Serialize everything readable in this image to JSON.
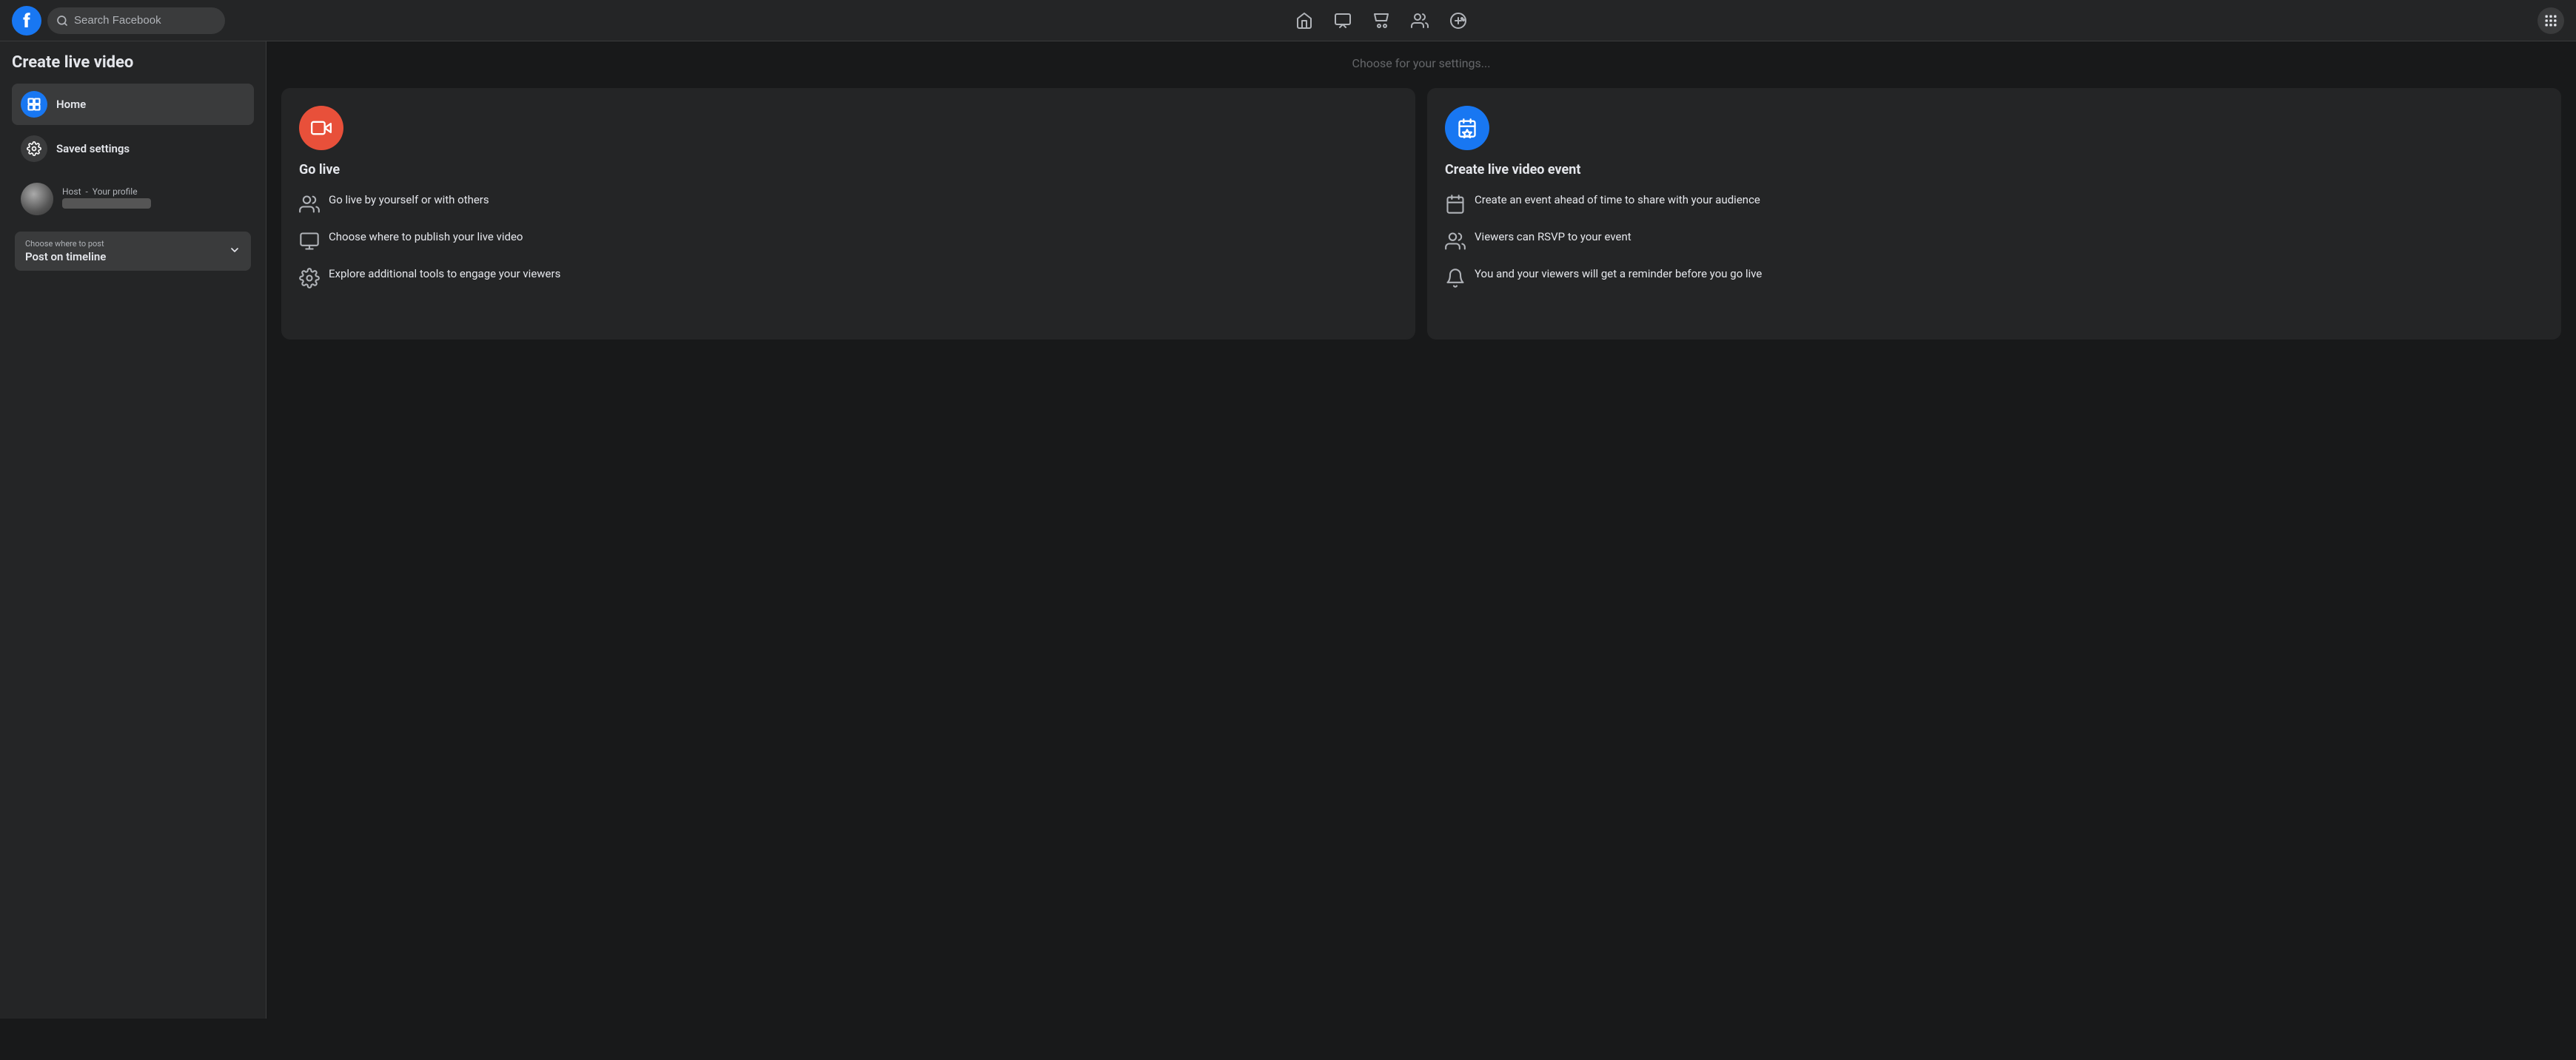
{
  "header": {
    "logo_letter": "f",
    "search_placeholder": "Search Facebook",
    "nav_items": [
      {
        "name": "home-nav",
        "label": "Home"
      },
      {
        "name": "watch-nav",
        "label": "Watch"
      },
      {
        "name": "marketplace-nav",
        "label": "Marketplace"
      },
      {
        "name": "friends-nav",
        "label": "Friends"
      },
      {
        "name": "gaming-nav",
        "label": "Gaming"
      }
    ],
    "grid_label": "Menu"
  },
  "sidebar": {
    "title": "Create live video",
    "items": [
      {
        "id": "home",
        "label": "Home",
        "active": true
      },
      {
        "id": "saved-settings",
        "label": "Saved settings",
        "active": false
      }
    ],
    "host": {
      "label": "Host",
      "name": "Your profile"
    },
    "choose_where": {
      "label": "Choose where to post",
      "value": "Post on timeline"
    }
  },
  "go_live_card": {
    "title": "Go live",
    "features": [
      {
        "text": "Go live by yourself or with others"
      },
      {
        "text": "Choose where to publish your live video"
      },
      {
        "text": "Explore additional tools to engage your viewers"
      }
    ]
  },
  "live_event_card": {
    "title": "Create live video event",
    "features": [
      {
        "text": "Create an event ahead of time to share with your audience"
      },
      {
        "text": "Viewers can RSVP to your event"
      },
      {
        "text": "You and your viewers will get a reminder before you go live"
      }
    ]
  }
}
